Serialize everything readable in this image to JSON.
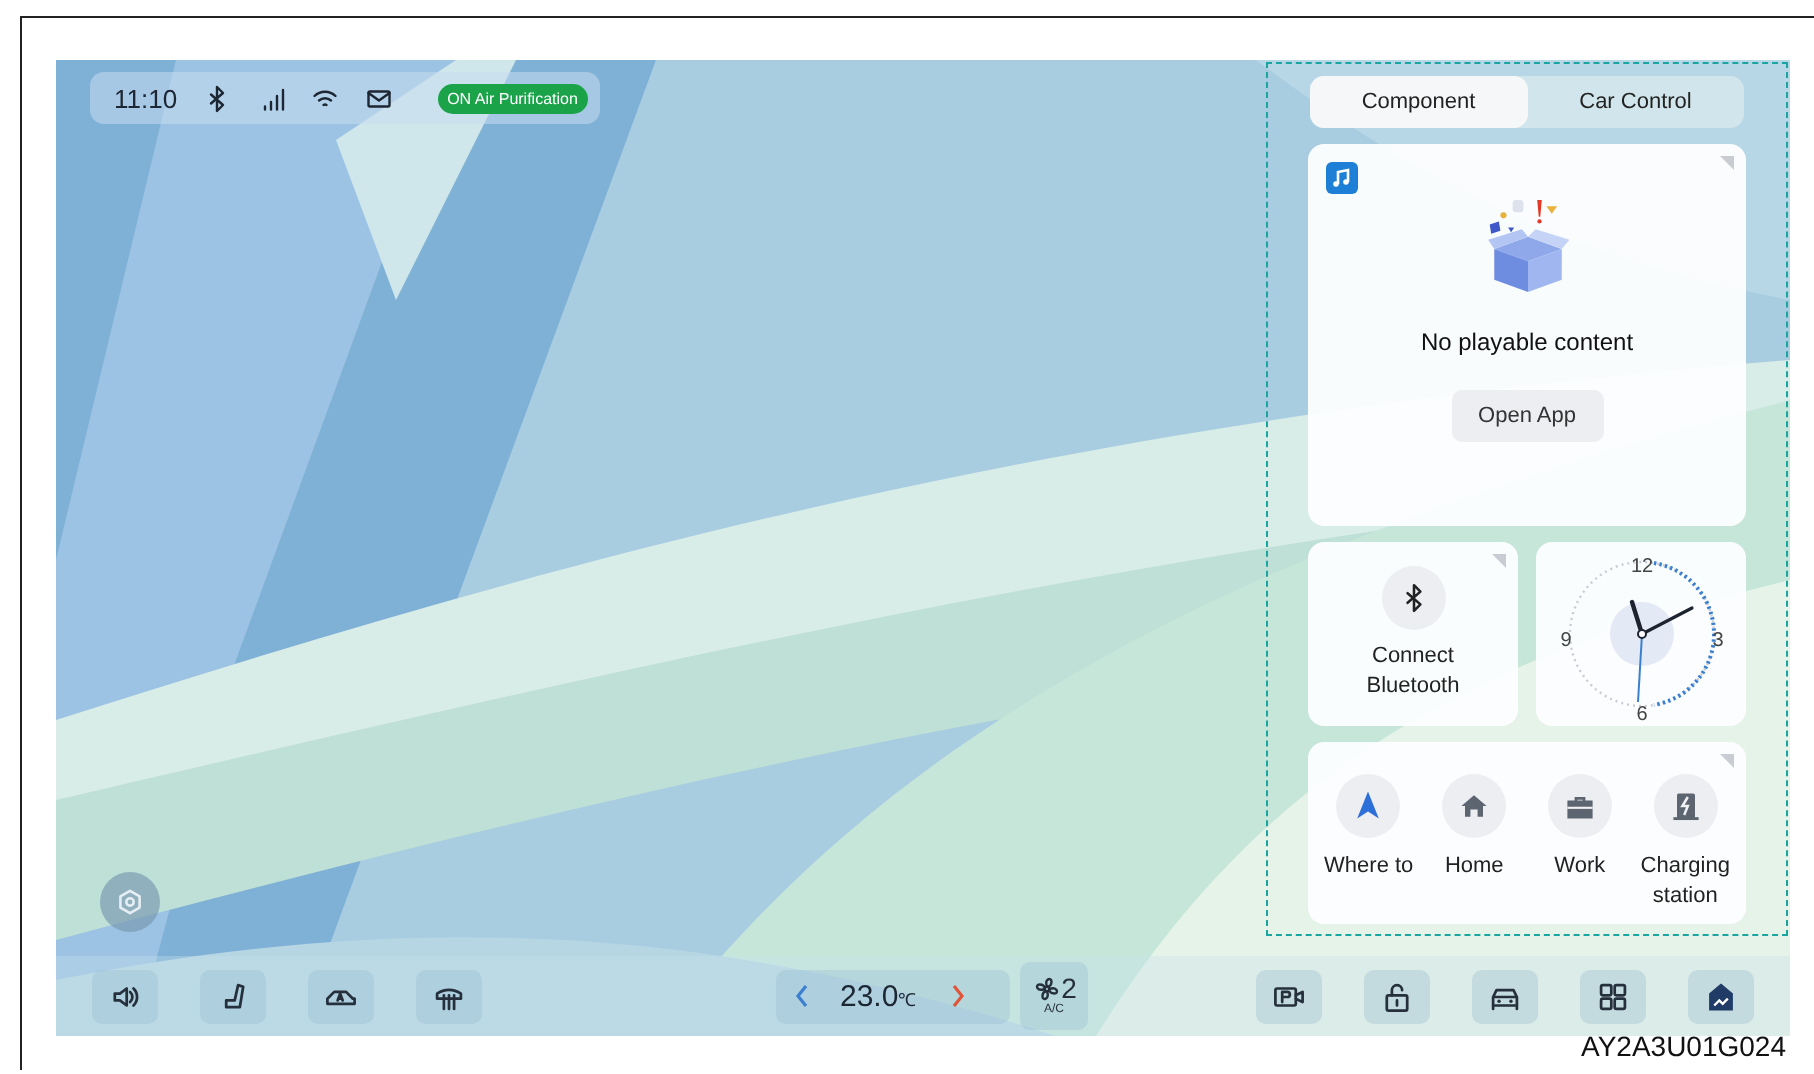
{
  "status_bar": {
    "time": "11:10",
    "icons": [
      {
        "kind": "bluetooth"
      },
      {
        "kind": "signal"
      },
      {
        "kind": "wifi"
      },
      {
        "kind": "mail"
      }
    ],
    "badge": "ON Air Purification"
  },
  "panel": {
    "tabs": [
      {
        "label": "Component",
        "selected": true
      },
      {
        "label": "Car Control",
        "selected": false
      }
    ],
    "music_card": {
      "message": "No playable content",
      "button": "Open App"
    },
    "bluetooth_card": {
      "label": "Connect Bluetooth"
    },
    "clock_card": {
      "numerals": [
        "12",
        "3",
        "6",
        "9"
      ]
    },
    "navigation_card": {
      "shortcuts": [
        {
          "kind": "navigate",
          "label": "Where to"
        },
        {
          "kind": "home",
          "label": "Home"
        },
        {
          "kind": "work",
          "label": "Work"
        },
        {
          "kind": "charging",
          "label": "Charging station"
        }
      ]
    }
  },
  "dock": {
    "left": [
      {
        "kind": "volume"
      },
      {
        "kind": "seat"
      },
      {
        "kind": "car-auto"
      },
      {
        "kind": "defrost"
      }
    ],
    "climate": {
      "temperature": "23.0",
      "unit": "℃",
      "fan_speed": "2",
      "ac_label": "A/C"
    },
    "right": [
      {
        "kind": "camera"
      },
      {
        "kind": "lock"
      },
      {
        "kind": "car"
      },
      {
        "kind": "apps"
      },
      {
        "kind": "navigation"
      }
    ]
  },
  "caption": "AY2A3U01G024"
}
